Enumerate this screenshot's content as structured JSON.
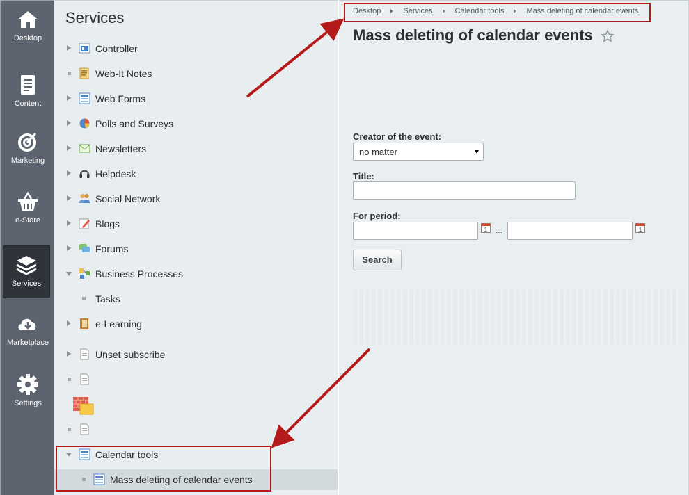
{
  "nav": {
    "items": [
      {
        "label": "Desktop",
        "icon": "home-icon"
      },
      {
        "label": "Content",
        "icon": "document-icon"
      },
      {
        "label": "Marketing",
        "icon": "target-icon"
      },
      {
        "label": "e-Store",
        "icon": "basket-icon"
      },
      {
        "label": "Services",
        "icon": "layers-icon",
        "active": true
      },
      {
        "label": "Marketplace",
        "icon": "cloud-download-icon"
      },
      {
        "label": "Settings",
        "icon": "gear-icon"
      }
    ]
  },
  "menu": {
    "title": "Services",
    "items": [
      {
        "label": "Controller",
        "icon": "controller-icon"
      },
      {
        "label": "Web-It Notes",
        "icon": "notes-icon"
      },
      {
        "label": "Web Forms",
        "icon": "form-icon"
      },
      {
        "label": "Polls and Surveys",
        "icon": "pie-icon"
      },
      {
        "label": "Newsletters",
        "icon": "envelope-icon"
      },
      {
        "label": "Helpdesk",
        "icon": "headset-icon"
      },
      {
        "label": "Social Network",
        "icon": "people-icon"
      },
      {
        "label": "Blogs",
        "icon": "pencil-icon"
      },
      {
        "label": "Forums",
        "icon": "chat-icon"
      },
      {
        "label": "Business Processes",
        "icon": "process-icon"
      },
      {
        "label": "Tasks",
        "icon": ""
      },
      {
        "label": "e-Learning",
        "icon": "book-icon"
      },
      {
        "label": "Unset subscribe",
        "icon": "page-icon"
      },
      {
        "label": "",
        "icon": "page-icon"
      },
      {
        "label": "",
        "icon": "firewall-icon"
      },
      {
        "label": "",
        "icon": "page-icon"
      },
      {
        "label": "Calendar tools",
        "icon": "form-icon"
      },
      {
        "label": "Mass deleting of calendar events",
        "icon": "form-icon"
      }
    ]
  },
  "breadcrumbs": [
    "Desktop",
    "Services",
    "Calendar tools",
    "Mass deleting of calendar events"
  ],
  "page": {
    "title": "Mass deleting of calendar events"
  },
  "form": {
    "creator_label": "Creator of the event:",
    "creator_value": "no matter",
    "title_label": "Title:",
    "title_value": "",
    "period_label": "For period:",
    "period_from": "",
    "period_to": "",
    "period_separator": "...",
    "calendar_day": "1",
    "search_label": "Search"
  },
  "colors": {
    "nav_bg": "#5d6470",
    "nav_active": "#2f343b",
    "highlight_box": "#b51a1a"
  }
}
